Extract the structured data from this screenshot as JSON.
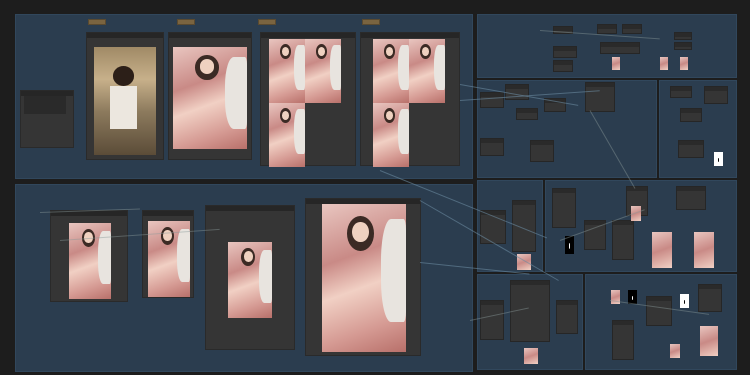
{
  "app": {
    "title": ""
  },
  "groups": [
    {
      "id": "group-top-left",
      "title": ""
    },
    {
      "id": "group-bottom-left",
      "title": ""
    },
    {
      "id": "group-right-top",
      "title": ""
    },
    {
      "id": "group-right-mid",
      "title": ""
    },
    {
      "id": "group-right-bottom",
      "title": ""
    }
  ],
  "nodes": [
    {
      "id": "node-load-image",
      "title": ""
    },
    {
      "id": "node-preview-1",
      "title": ""
    },
    {
      "id": "node-preview-2",
      "title": ""
    },
    {
      "id": "node-preview-3",
      "title": ""
    },
    {
      "id": "node-preview-4",
      "title": ""
    },
    {
      "id": "node-preview-5",
      "title": ""
    },
    {
      "id": "node-preview-6",
      "title": ""
    },
    {
      "id": "node-preview-7",
      "title": ""
    }
  ],
  "colors": {
    "canvas": "#1d1d1d",
    "group": "#2b3d4f",
    "node": "#353535",
    "tag": "#7a6440",
    "wire": "#6a8aa0"
  },
  "icons": {
    "reroute": "reroute-dot-icon"
  }
}
